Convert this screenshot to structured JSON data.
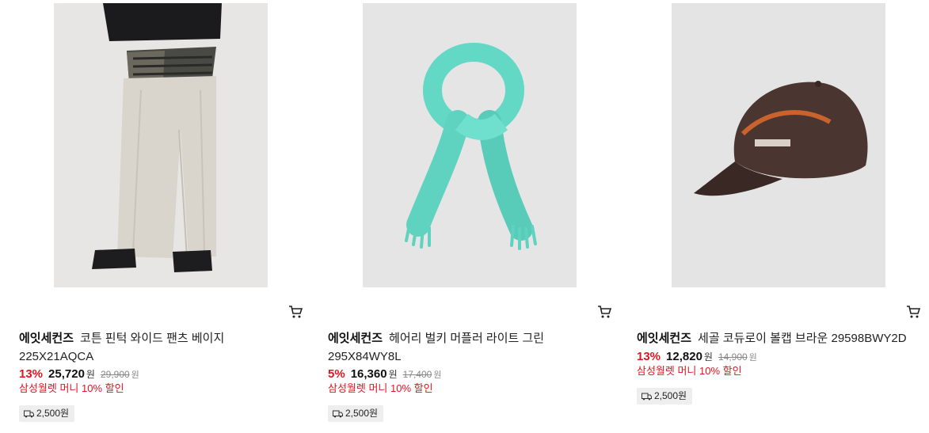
{
  "products": [
    {
      "image": "wide-cotton-pants-beige-photo",
      "brand": "에잇세컨즈",
      "name": "코튼 핀턱 와이드 팬츠 베이지",
      "code": "225X21AQCA",
      "discount": "13%",
      "price": "25,720",
      "currency": "원",
      "original_price": "29,900",
      "original_currency": "원",
      "promo": "삼성월렛 머니 10% 할인",
      "shipping": "2,500원",
      "cart_icon": "cart-icon",
      "bg_color": "#e6e6e6"
    },
    {
      "image": "hairy-bulky-muffler-light-green-photo",
      "brand": "에잇세컨즈",
      "name": "헤어리 벌키 머플러 라이트 그린",
      "code": "295X84WY8L",
      "discount": "5%",
      "price": "16,360",
      "currency": "원",
      "original_price": "17,400",
      "original_currency": "원",
      "promo": "삼성월렛 머니 10% 할인",
      "shipping": "2,500원",
      "cart_icon": "cart-icon",
      "bg_color": "#e5e5e6"
    },
    {
      "image": "corduroy-ball-cap-brown-photo",
      "brand": "에잇세컨즈",
      "name": "세골 코듀로이 볼캡 브라운 29598BWY2D",
      "code": "",
      "discount": "13%",
      "price": "12,820",
      "currency": "원",
      "original_price": "14,900",
      "original_currency": "원",
      "promo": "삼성월렛 머니 10% 할인",
      "shipping": "2,500원",
      "cart_icon": "cart-icon",
      "bg_color": "#e4e4e4"
    }
  ],
  "colors": {
    "discount": "#e0151e",
    "promo": "#e0151e",
    "ship_bg": "#eeeeee"
  }
}
